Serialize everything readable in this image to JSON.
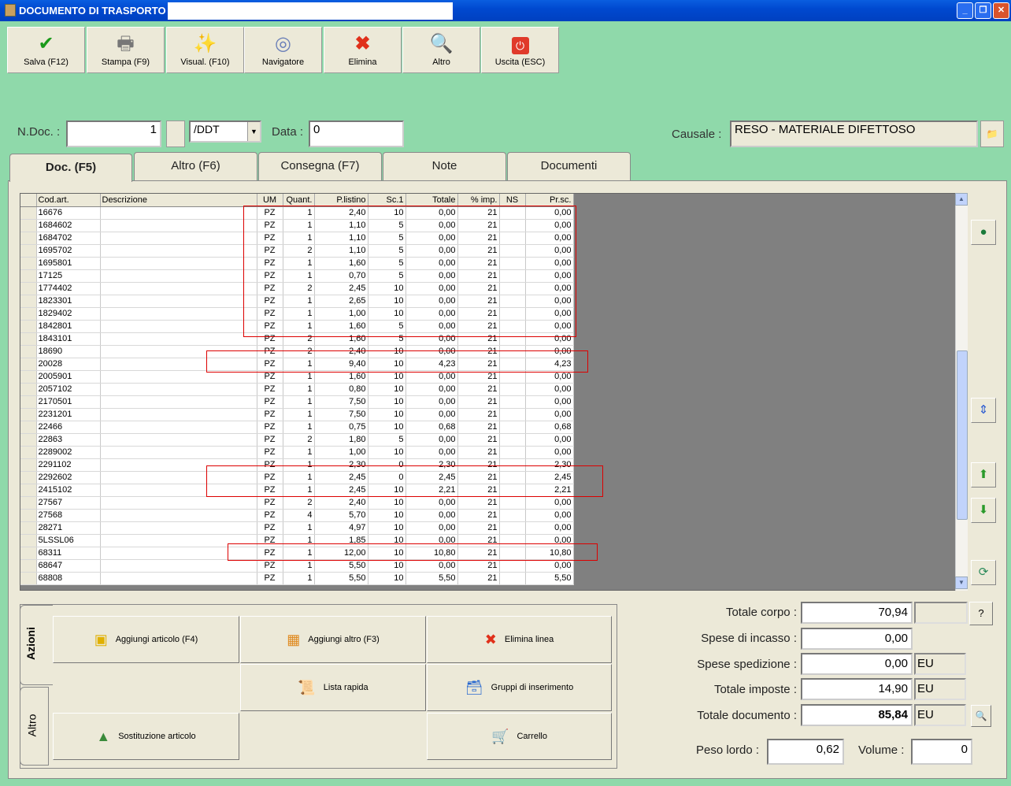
{
  "window": {
    "title": "DOCUMENTO DI TRASPORTO N."
  },
  "toolbar": [
    {
      "label": "Salva (F12)",
      "icon": "check-icon"
    },
    {
      "label": "Stampa (F9)",
      "icon": "printer-icon"
    },
    {
      "label": "Visual. (F10)",
      "icon": "magic-wand-icon"
    },
    {
      "label": "Navigatore",
      "icon": "compass-icon"
    },
    {
      "label": "Elimina",
      "icon": "delete-x-icon"
    },
    {
      "label": "Altro",
      "icon": "magnifier-book-icon"
    },
    {
      "label": "Uscita (ESC)",
      "icon": "power-icon"
    }
  ],
  "header": {
    "ndoc_label": "N.Doc. :",
    "ndoc_value": "1",
    "series_value": "/DDT",
    "data_label": "Data :",
    "data_value": "0",
    "causale_label": "Causale :",
    "causale_value": "RESO - MATERIALE DIFETTOSO"
  },
  "tabs": [
    "Doc. (F5)",
    "Altro (F6)",
    "Consegna (F7)",
    "Note",
    "Documenti"
  ],
  "grid": {
    "columns": [
      "Cod.art.",
      "Descrizione",
      "UM",
      "Quant.",
      "P.listino",
      "Sc.1",
      "Totale",
      "% imp.",
      "NS",
      "Pr.sc."
    ],
    "rows": [
      [
        "16676",
        "",
        "PZ",
        "1",
        "2,40",
        "10",
        "0,00",
        "21",
        "",
        "0,00"
      ],
      [
        "1684602",
        "",
        "PZ",
        "1",
        "1,10",
        "5",
        "0,00",
        "21",
        "",
        "0,00"
      ],
      [
        "1684702",
        "",
        "PZ",
        "1",
        "1,10",
        "5",
        "0,00",
        "21",
        "",
        "0,00"
      ],
      [
        "1695702",
        "",
        "PZ",
        "2",
        "1,10",
        "5",
        "0,00",
        "21",
        "",
        "0,00"
      ],
      [
        "1695801",
        "",
        "PZ",
        "1",
        "1,60",
        "5",
        "0,00",
        "21",
        "",
        "0,00"
      ],
      [
        "17125",
        "",
        "PZ",
        "1",
        "0,70",
        "5",
        "0,00",
        "21",
        "",
        "0,00"
      ],
      [
        "1774402",
        "",
        "PZ",
        "2",
        "2,45",
        "10",
        "0,00",
        "21",
        "",
        "0,00"
      ],
      [
        "1823301",
        "",
        "PZ",
        "1",
        "2,65",
        "10",
        "0,00",
        "21",
        "",
        "0,00"
      ],
      [
        "1829402",
        "",
        "PZ",
        "1",
        "1,00",
        "10",
        "0,00",
        "21",
        "",
        "0,00"
      ],
      [
        "1842801",
        "",
        "PZ",
        "1",
        "1,60",
        "5",
        "0,00",
        "21",
        "",
        "0,00"
      ],
      [
        "1843101",
        "",
        "PZ",
        "2",
        "1,60",
        "5",
        "0,00",
        "21",
        "",
        "0,00"
      ],
      [
        "18690",
        "",
        "PZ",
        "2",
        "2,40",
        "10",
        "0,00",
        "21",
        "",
        "0,00"
      ],
      [
        "20028",
        "",
        "PZ",
        "1",
        "9,40",
        "10",
        "4,23",
        "21",
        "",
        "4,23"
      ],
      [
        "2005901",
        "",
        "PZ",
        "1",
        "1,60",
        "10",
        "0,00",
        "21",
        "",
        "0,00"
      ],
      [
        "2057102",
        "",
        "PZ",
        "1",
        "0,80",
        "10",
        "0,00",
        "21",
        "",
        "0,00"
      ],
      [
        "2170501",
        "",
        "PZ",
        "1",
        "7,50",
        "10",
        "0,00",
        "21",
        "",
        "0,00"
      ],
      [
        "2231201",
        "",
        "PZ",
        "1",
        "7,50",
        "10",
        "0,00",
        "21",
        "",
        "0,00"
      ],
      [
        "22466",
        "",
        "PZ",
        "1",
        "0,75",
        "10",
        "0,68",
        "21",
        "",
        "0,68"
      ],
      [
        "22863",
        "",
        "PZ",
        "2",
        "1,80",
        "5",
        "0,00",
        "21",
        "",
        "0,00"
      ],
      [
        "2289002",
        "",
        "PZ",
        "1",
        "1,00",
        "10",
        "0,00",
        "21",
        "",
        "0,00"
      ],
      [
        "2291102",
        "",
        "PZ",
        "1",
        "2,30",
        "0",
        "2,30",
        "21",
        "",
        "2,30"
      ],
      [
        "2292602",
        "",
        "PZ",
        "1",
        "2,45",
        "0",
        "2,45",
        "21",
        "",
        "2,45"
      ],
      [
        "2415102",
        "",
        "PZ",
        "1",
        "2,45",
        "10",
        "2,21",
        "21",
        "",
        "2,21"
      ],
      [
        "27567",
        "",
        "PZ",
        "2",
        "2,40",
        "10",
        "0,00",
        "21",
        "",
        "0,00"
      ],
      [
        "27568",
        "",
        "PZ",
        "4",
        "5,70",
        "10",
        "0,00",
        "21",
        "",
        "0,00"
      ],
      [
        "28271",
        "",
        "PZ",
        "1",
        "4,97",
        "10",
        "0,00",
        "21",
        "",
        "0,00"
      ],
      [
        "5LSSL06",
        "",
        "PZ",
        "1",
        "1,85",
        "10",
        "0,00",
        "21",
        "",
        "0,00"
      ],
      [
        "68311",
        "",
        "PZ",
        "1",
        "12,00",
        "10",
        "10,80",
        "21",
        "",
        "10,80"
      ],
      [
        "68647",
        "",
        "PZ",
        "1",
        "5,50",
        "10",
        "0,00",
        "21",
        "",
        "0,00"
      ],
      [
        "68808",
        "",
        "PZ",
        "1",
        "5,50",
        "10",
        "5,50",
        "21",
        "",
        "5,50"
      ]
    ]
  },
  "actions": {
    "tab_azioni": "Azioni",
    "tab_altro": "Altro",
    "aggiungi_articolo": "Aggiungi articolo (F4)",
    "aggiungi_altro": "Aggiungi altro (F3)",
    "elimina_linea": "Elimina linea",
    "lista_rapida": "Lista rapida",
    "gruppi": "Gruppi di inserimento",
    "sostituzione": "Sostituzione articolo",
    "carrello": "Carrello"
  },
  "totals": {
    "totale_corpo_label": "Totale corpo :",
    "totale_corpo": "70,94",
    "spese_incasso_label": "Spese di incasso :",
    "spese_incasso": "0,00",
    "spese_spedizione_label": "Spese spedizione :",
    "spese_spedizione": "0,00",
    "spese_spedizione_unit": "EU",
    "totale_imposte_label": "Totale imposte :",
    "totale_imposte": "14,90",
    "totale_imposte_unit": "EU",
    "totale_documento_label": "Totale documento :",
    "totale_documento": "85,84",
    "totale_documento_unit": "EU",
    "peso_lordo_label": "Peso lordo :",
    "peso_lordo": "0,62",
    "volume_label": "Volume :",
    "volume": "0",
    "help_label": "?"
  },
  "colors": {
    "background": "#8fd9aa",
    "panel": "#ece9d8",
    "annotation": "#dd0000"
  }
}
